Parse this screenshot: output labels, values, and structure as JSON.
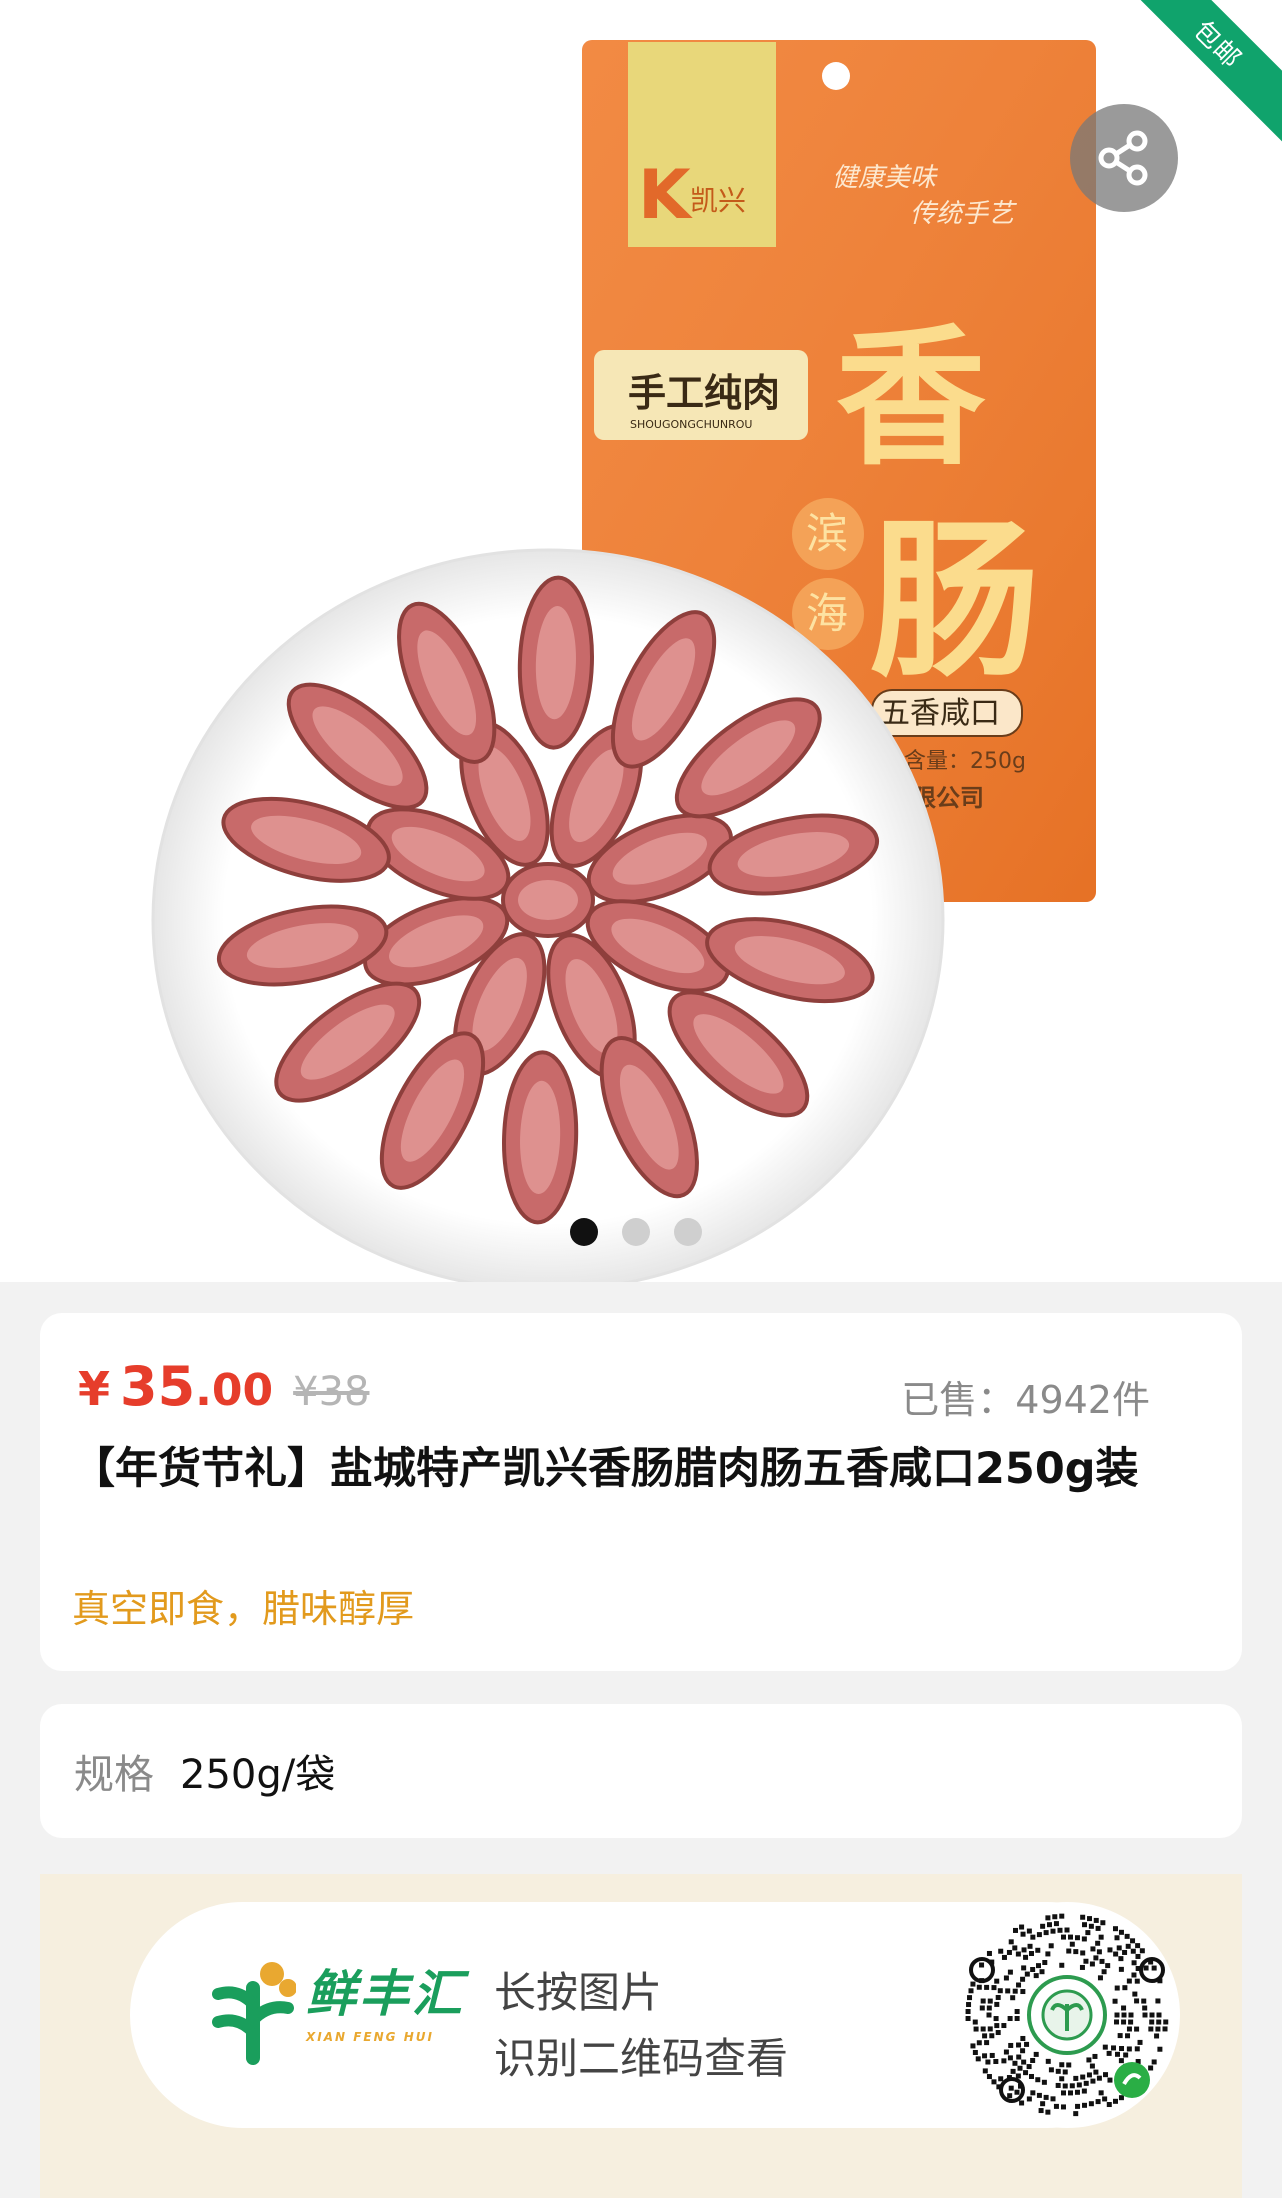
{
  "badge": {
    "label": "包邮"
  },
  "product_image": {
    "package": {
      "brand_letter": "K",
      "brand_name": "凯兴",
      "slogan_1": "健康美味",
      "slogan_2": "传统手艺",
      "tag_main": "手工纯肉",
      "tag_pinyin": "SHOUGONGCHUNROU",
      "big_char_1": "香",
      "big_char_2": "肠",
      "region_1": "滨",
      "region_2": "海",
      "flavor": "五香咸口",
      "weight": "含量：250g",
      "company": "限公司"
    }
  },
  "carousel": {
    "count": 3,
    "active_index": 0
  },
  "product": {
    "currency": "¥",
    "price_integer": "35",
    "price_decimal": ".00",
    "original_price": "¥38",
    "sold": "已售：4942件",
    "title": "【年货节礼】盐城特产凯兴香肠腊肉肠五香咸口250g装",
    "subtitle": "真空即食，腊味醇厚"
  },
  "spec": {
    "label": "规格",
    "value": "250g/袋"
  },
  "promo": {
    "logo_text": "鲜丰汇",
    "logo_sub": "XIAN FENG HUI",
    "line1": "长按图片",
    "line2": "识别二维码查看"
  },
  "colors": {
    "price": "#e63d2b",
    "subtitle": "#e29a1d",
    "badge": "#10a36c",
    "package": "#f07a2a",
    "brand_green": "#1a9e5c"
  }
}
